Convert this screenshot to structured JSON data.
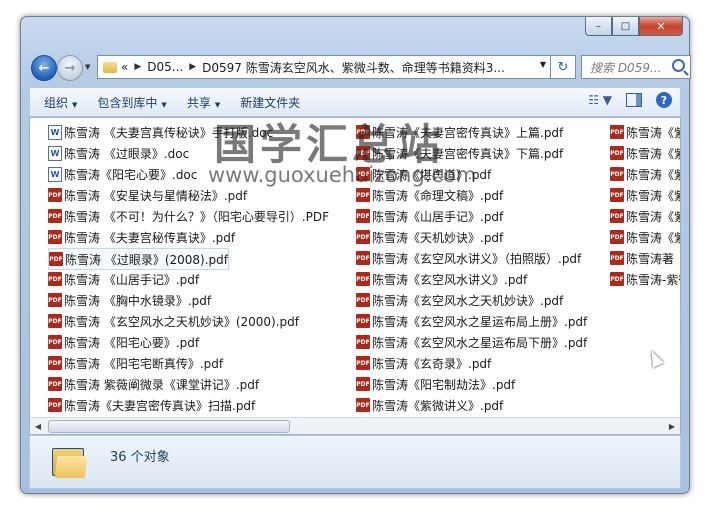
{
  "window": {
    "buttons": {
      "minimize": "–",
      "maximize": "□",
      "close": "✕"
    }
  },
  "nav": {
    "address_prefix": "«",
    "crumbs": [
      "D05...",
      "D0597 陈雪涛玄空风水、紫微斗数、命理等书籍资料3..."
    ],
    "search_placeholder": "搜索 D059..."
  },
  "toolbar": {
    "items": [
      "组织",
      "包含到库中",
      "共享",
      "新建文件夹"
    ]
  },
  "files": {
    "col1": [
      {
        "type": "doc",
        "name": "陈雪涛 《夫妻宫真传秘诀》手打版.doc"
      },
      {
        "type": "doc",
        "name": "陈雪涛 《过眼录》.doc"
      },
      {
        "type": "doc",
        "name": "陈雪涛《阳宅心要》.doc"
      },
      {
        "type": "pdf",
        "name": "陈雪涛 《安星诀与星情秘法》.pdf"
      },
      {
        "type": "pdf",
        "name": "陈雪涛 《不可！为什么？》（阳宅心要导引）.PDF"
      },
      {
        "type": "pdf",
        "name": "陈雪涛 《夫妻宫秘传真诀》.pdf"
      },
      {
        "type": "pdf",
        "name": "陈雪涛 《过眼录》(2008).pdf"
      },
      {
        "type": "pdf",
        "name": "陈雪涛 《山居手记》.pdf"
      },
      {
        "type": "pdf",
        "name": "陈雪涛 《胸中水镜录》.pdf"
      },
      {
        "type": "pdf",
        "name": "陈雪涛 《玄空风水之天机妙诀》(2000).pdf"
      },
      {
        "type": "pdf",
        "name": "陈雪涛 《阳宅心要》.pdf"
      },
      {
        "type": "pdf",
        "name": "陈雪涛 《阳宅宅断真传》.pdf"
      },
      {
        "type": "pdf",
        "name": "陈雪涛 紫薇阐微录《课堂讲记》.pdf"
      },
      {
        "type": "pdf",
        "name": "陈雪涛《夫妻宫密传真诀》扫描.pdf"
      }
    ],
    "col2": [
      {
        "type": "pdf",
        "name": "陈雪涛《夫妻宫密传真诀》上篇.pdf"
      },
      {
        "type": "pdf",
        "name": "陈雪涛《夫妻宫密传真诀》下篇.pdf"
      },
      {
        "type": "pdf",
        "name": "陈雪涛《堪舆道》.pdf"
      },
      {
        "type": "pdf",
        "name": "陈雪涛《命理文稿》.pdf"
      },
      {
        "type": "pdf",
        "name": "陈雪涛《山居手记》.pdf"
      },
      {
        "type": "pdf",
        "name": "陈雪涛《天机妙诀》.pdf"
      },
      {
        "type": "pdf",
        "name": "陈雪涛《玄空风水讲义》（拍照版）.pdf"
      },
      {
        "type": "pdf",
        "name": "陈雪涛《玄空风水讲义》.pdf"
      },
      {
        "type": "pdf",
        "name": "陈雪涛《玄空风水之天机妙诀》.pdf"
      },
      {
        "type": "pdf",
        "name": "陈雪涛《玄空风水之星运布局上册》.pdf"
      },
      {
        "type": "pdf",
        "name": "陈雪涛《玄空风水之星运布局下册》.pdf"
      },
      {
        "type": "pdf",
        "name": "陈雪涛《玄奇录》.pdf"
      },
      {
        "type": "pdf",
        "name": "陈雪涛《阳宅制劫法》.pdf"
      },
      {
        "type": "pdf",
        "name": "陈雪涛《紫微讲义》.pdf"
      }
    ],
    "col3": [
      {
        "type": "pdf",
        "name": "陈雪涛《紫"
      },
      {
        "type": "pdf",
        "name": "陈雪涛《紫"
      },
      {
        "type": "pdf",
        "name": "陈雪涛《紫"
      },
      {
        "type": "pdf",
        "name": "陈雪涛《紫"
      },
      {
        "type": "pdf",
        "name": "陈雪涛《紫"
      },
      {
        "type": "pdf",
        "name": "陈雪涛《紫"
      },
      {
        "type": "pdf",
        "name": "陈雪涛著《"
      },
      {
        "type": "pdf",
        "name": "陈雪涛-紫微"
      }
    ]
  },
  "watermark": {
    "text": "国学汇总站",
    "url": "www.guoxuehuizong.com"
  },
  "status": {
    "count": "36 个对象"
  }
}
